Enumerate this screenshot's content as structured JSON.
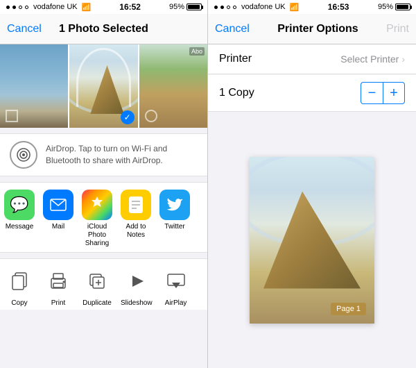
{
  "left": {
    "status": {
      "carrier": "vodafone UK",
      "time": "16:52",
      "battery": "95%"
    },
    "nav": {
      "cancel": "Cancel",
      "title": "1 Photo Selected"
    },
    "airdrop": {
      "text": "AirDrop. Tap to turn on Wi-Fi and Bluetooth to share with AirDrop."
    },
    "shareItems": [
      {
        "id": "message",
        "label": "Message",
        "iconClass": "icon-message",
        "icon": "💬"
      },
      {
        "id": "mail",
        "label": "Mail",
        "iconClass": "icon-mail",
        "icon": "✉️"
      },
      {
        "id": "icloud-photos",
        "label": "iCloud Photo Sharing",
        "iconClass": "icon-photos",
        "icon": "⬡"
      },
      {
        "id": "add-notes",
        "label": "Add to Notes",
        "iconClass": "icon-notes",
        "icon": "📝"
      },
      {
        "id": "twitter",
        "label": "Twitter",
        "iconClass": "icon-twitter",
        "icon": "🐦"
      }
    ],
    "actionItems": [
      {
        "id": "copy",
        "label": "Copy",
        "icon": "⬜"
      },
      {
        "id": "print",
        "label": "Print",
        "icon": "🖨"
      },
      {
        "id": "duplicate",
        "label": "Duplicate",
        "icon": "⊞"
      },
      {
        "id": "slideshow",
        "label": "Slideshow",
        "icon": "▶"
      },
      {
        "id": "airplay",
        "label": "AirPlay",
        "icon": "⬜"
      }
    ]
  },
  "right": {
    "status": {
      "carrier": "vodafone UK",
      "time": "16:53",
      "battery": "95%"
    },
    "nav": {
      "cancel": "Cancel",
      "title": "Printer Options",
      "print": "Print"
    },
    "printer": {
      "label": "Printer",
      "value": "Select Printer"
    },
    "copies": {
      "label": "1 Copy",
      "minus": "−",
      "plus": "+"
    },
    "preview": {
      "pageBadge": "Page 1"
    }
  }
}
